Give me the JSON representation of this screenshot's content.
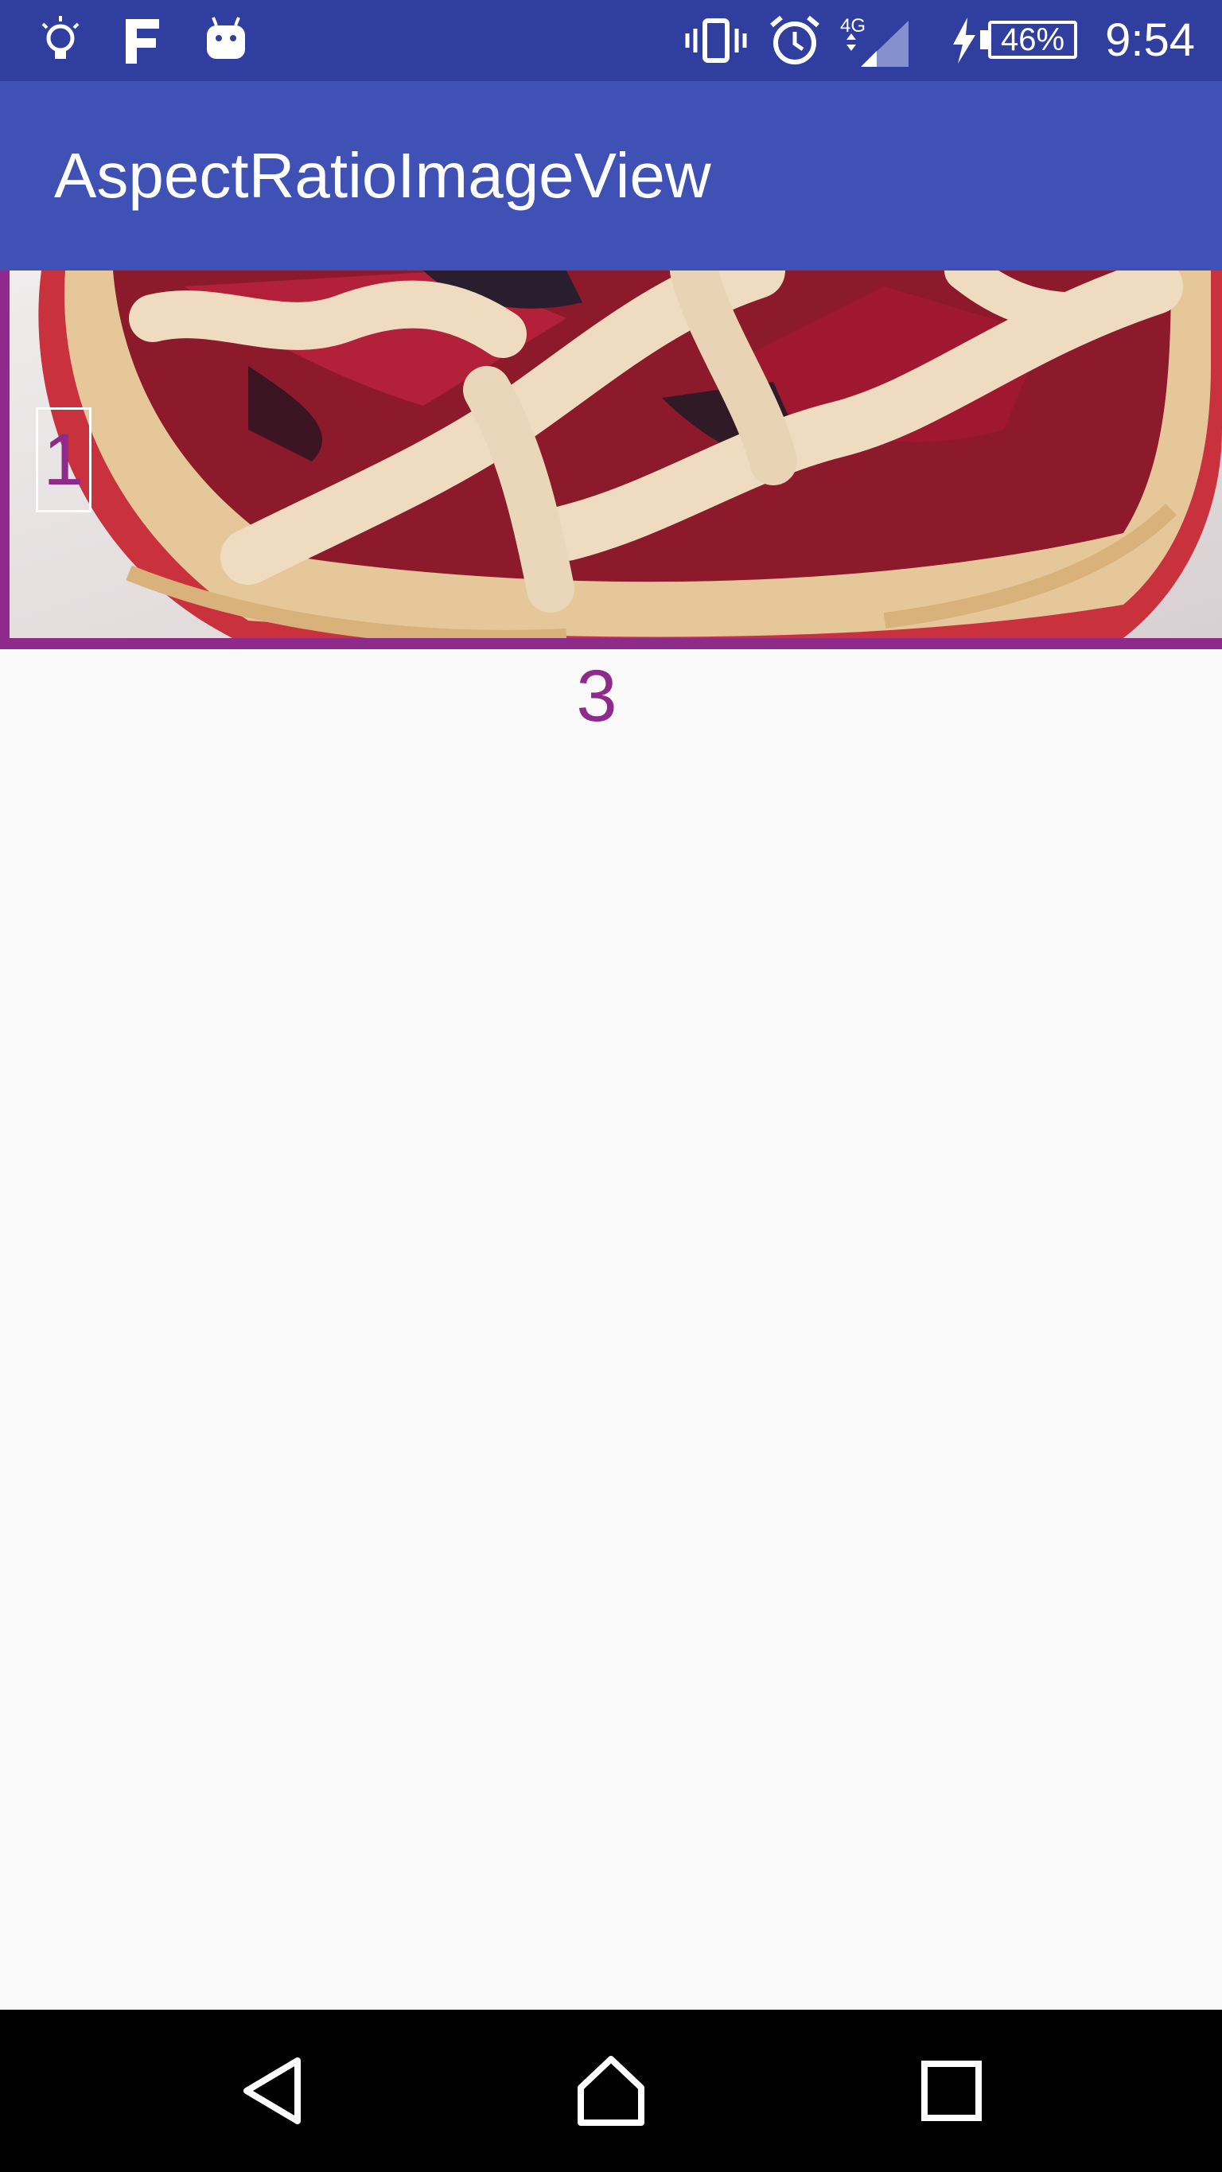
{
  "status_bar": {
    "time": "9:54",
    "battery_percent": "46%",
    "network_type": "4G",
    "icons": [
      "lightbulb-icon",
      "f-app-icon",
      "android-icon",
      "vibrate-icon",
      "alarm-icon",
      "signal-icon",
      "charging-icon",
      "battery-icon"
    ]
  },
  "app_bar": {
    "title": "AspectRatioImageView"
  },
  "content": {
    "image_label_1": "1",
    "image_label_3": "3"
  },
  "colors": {
    "status_bar": "#303f9f",
    "app_bar": "#3f51b5",
    "accent_purple": "#8e2a8b",
    "background": "#fafafa"
  },
  "nav_bar": {
    "buttons": [
      "back-icon",
      "home-icon",
      "recents-icon"
    ]
  }
}
